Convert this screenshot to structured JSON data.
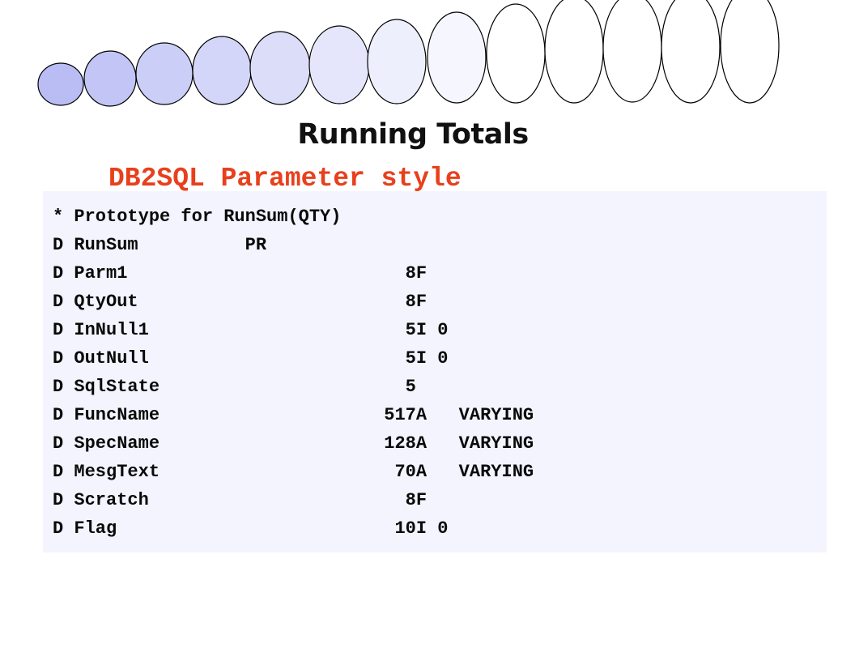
{
  "title": "Running Totals",
  "subtitle": "DB2SQL Parameter style",
  "code_lines": [
    "* Prototype for RunSum(QTY)",
    "D RunSum          PR",
    "D Parm1                          8F",
    "D QtyOut                         8F",
    "D InNull1                        5I 0",
    "D OutNull                        5I 0",
    "D SqlState                       5",
    "D FuncName                     517A   VARYING",
    "D SpecName                     128A   VARYING",
    "D MesgText                      70A   VARYING",
    "D Scratch                        8F",
    "D Flag                          10I 0"
  ],
  "colors": {
    "subtitle": "#e8401c",
    "code_background": "#f3f4fd",
    "ellipse_fill_dark": "#b9bdf3",
    "ellipse_fill_light": "#ffffff"
  },
  "decoration": "row of ovals increasing in size from left to right, fading from lavender to white"
}
